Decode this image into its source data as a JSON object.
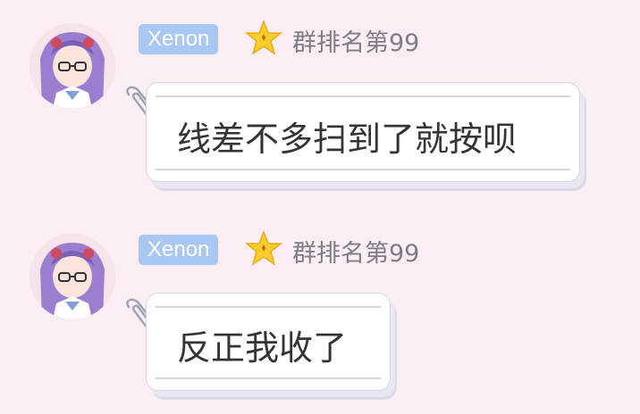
{
  "messages": [
    {
      "sender": "Xenon",
      "badge_icon": "star-icon",
      "rank": "群排名第99",
      "text": "线差不多扫到了就按呗"
    },
    {
      "sender": "Xenon",
      "badge_icon": "star-icon",
      "rank": "群排名第99",
      "text": "反正我收了"
    }
  ],
  "colors": {
    "background": "#fbeef4",
    "name_tag": "#a9c7f3",
    "star": "#f7cf2b",
    "bubble": "#ffffff",
    "text": "#333338",
    "rank_text": "#7d7d86"
  }
}
